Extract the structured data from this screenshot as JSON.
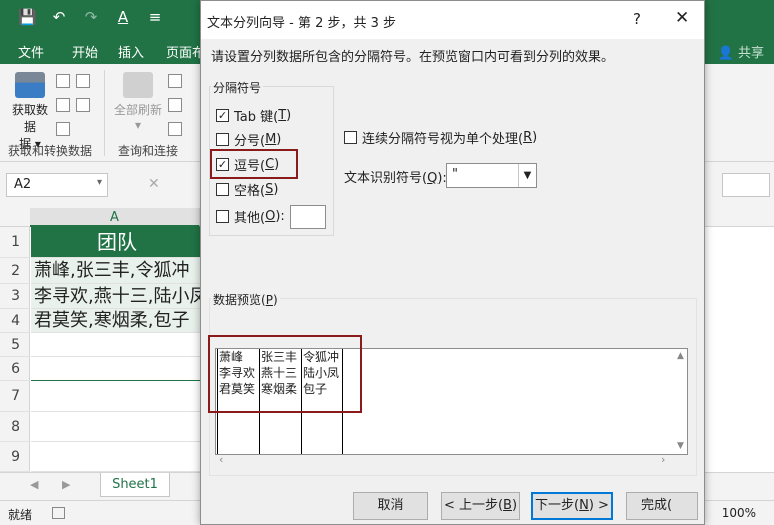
{
  "excel": {
    "qat": {
      "save_icon": "💾",
      "undo_icon": "↶",
      "redo_icon": "↷",
      "font_color_icon": "A",
      "customize_icon": "≡"
    },
    "tabs": [
      "文件",
      "开始",
      "插入",
      "页面布"
    ],
    "share_label": "共享",
    "ribbon": {
      "get_data_label": "获取数据",
      "get_data_sub": "据",
      "group1_label": "获取和转换数据",
      "refresh_all_label": "全部刷新",
      "group2_label": "查询和连接"
    },
    "name_box": "A2",
    "cancel_glyph": "✕",
    "column_a": "A",
    "rows": [
      {
        "num": "1",
        "value": "团队"
      },
      {
        "num": "2",
        "value": "萧峰,张三丰,令狐冲"
      },
      {
        "num": "3",
        "value": "李寻欢,燕十三,陆小凤"
      },
      {
        "num": "4",
        "value": "君莫笑,寒烟柔,包子"
      },
      {
        "num": "5",
        "value": ""
      },
      {
        "num": "6",
        "value": ""
      },
      {
        "num": "7",
        "value": ""
      },
      {
        "num": "8",
        "value": ""
      },
      {
        "num": "9",
        "value": ""
      }
    ],
    "sheet_tab": "Sheet1",
    "status": "就绪",
    "zoom": "100%"
  },
  "dialog": {
    "title": "文本分列向导 - 第 2 步，共 3 步",
    "help": "?",
    "close": "✕",
    "instructions": "请设置分列数据所包含的分隔符号。在预览窗口内可看到分列的效果。",
    "delimiters_caption": "分隔符号",
    "delimiters": [
      {
        "label": "Tab 键(",
        "key": "T",
        "suffix": ")",
        "checked": true
      },
      {
        "label": "分号(",
        "key": "M",
        "suffix": ")",
        "checked": false
      },
      {
        "label": "逗号(",
        "key": "C",
        "suffix": ")",
        "checked": true
      },
      {
        "label": "空格(",
        "key": "S",
        "suffix": ")",
        "checked": false
      },
      {
        "label": "其他(",
        "key": "O",
        "suffix": "):",
        "checked": false
      }
    ],
    "consecutive_label": "连续分隔符号视为单个处理(",
    "consecutive_key": "R",
    "consecutive_suffix": ")",
    "qualifier_label": "文本识别符号(",
    "qualifier_key": "Q",
    "qualifier_suffix": "):",
    "qualifier_value": "\"",
    "preview_caption": "数据预览(",
    "preview_key": "P",
    "preview_suffix": ")",
    "preview_columns": [
      [
        "萧峰",
        "李寻欢",
        "君莫笑"
      ],
      [
        "张三丰",
        "燕十三",
        "寒烟柔"
      ],
      [
        "令狐冲",
        "陆小凤",
        "包子"
      ]
    ],
    "buttons": {
      "cancel": "取消",
      "back": "< 上一步(",
      "back_key": "B",
      "back_suffix": ")",
      "next": "下一步(",
      "next_key": "N",
      "next_suffix": ") >",
      "finish": "完成("
    },
    "highlight_color": "#8b1a1a",
    "accent_color": "#0078d7"
  }
}
